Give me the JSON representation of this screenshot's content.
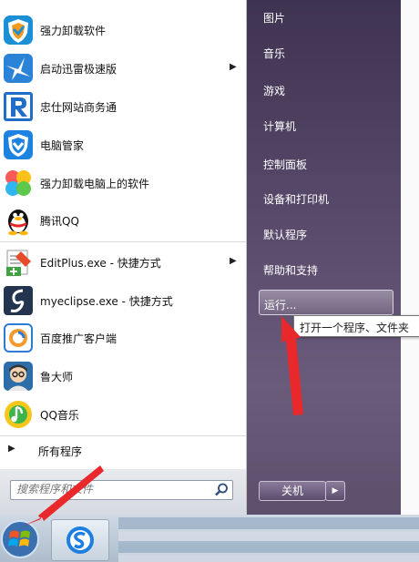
{
  "start_menu": {
    "programs": [
      {
        "label": "强力卸载软件",
        "icon": "shield-uninstall-icon"
      },
      {
        "label": "启动迅雷极速版",
        "icon": "thunder-bird-icon",
        "has_submenu": true
      },
      {
        "label": "忠仕网站商务通",
        "icon": "r-logo-icon"
      },
      {
        "label": "电脑管家",
        "icon": "pc-manager-shield-icon"
      },
      {
        "label": "强力卸载电脑上的软件",
        "icon": "butterfly-icon"
      },
      {
        "label": "腾讯QQ",
        "icon": "qq-penguin-icon"
      },
      {
        "label": "EditPlus.exe - 快捷方式",
        "icon": "editplus-icon",
        "has_submenu": true
      },
      {
        "label": "myeclipse.exe - 快捷方式",
        "icon": "myeclipse-icon"
      },
      {
        "label": "百度推广客户端",
        "icon": "baidu-promo-icon"
      },
      {
        "label": "鲁大师",
        "icon": "ludashi-icon"
      },
      {
        "label": "QQ音乐",
        "icon": "qq-music-icon"
      }
    ],
    "all_programs": "所有程序",
    "search_placeholder": "搜索程序和文件",
    "right_items": [
      "图片",
      "音乐",
      "游戏",
      "计算机",
      "控制面板",
      "设备和打印机",
      "默认程序",
      "帮助和支持"
    ],
    "run_label": "运行...",
    "run_tooltip": "打开一个程序、文件夹",
    "shutdown_label": "关机"
  },
  "colors": {
    "panel_dark": "#4b3e5c",
    "annotation_red": "#e8282b"
  }
}
